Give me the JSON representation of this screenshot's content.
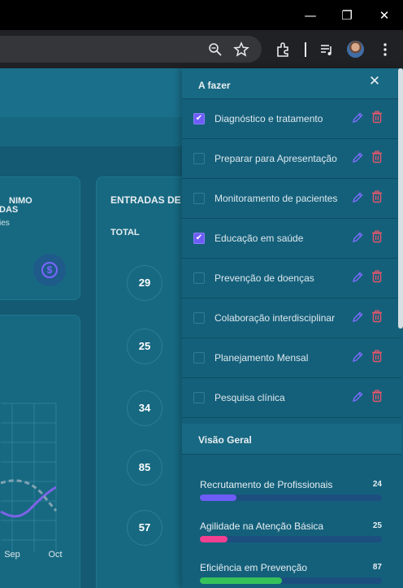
{
  "browser": {
    "window_buttons": [
      "—",
      "❐",
      "✕"
    ]
  },
  "dashboard": {
    "card_min": {
      "title_line1": "NIMO",
      "title_line2": "DAS",
      "subtitle": "ies"
    },
    "chart": {
      "x_labels": [
        "Sep",
        "Oct"
      ]
    },
    "entradas": {
      "title": "ENTRADAS DE",
      "total_label": "TOTAL",
      "values": [
        "29",
        "25",
        "34",
        "85",
        "57"
      ]
    }
  },
  "panel": {
    "title": "A fazer",
    "tasks": [
      {
        "label": "Diagnóstico e tratamento",
        "checked": true
      },
      {
        "label": "Preparar para Apresentação",
        "checked": false
      },
      {
        "label": "Monitoramento de pacientes",
        "checked": false
      },
      {
        "label": "Educação em saúde",
        "checked": true
      },
      {
        "label": "Prevenção de doenças",
        "checked": false
      },
      {
        "label": "Colaboração interdisciplinar",
        "checked": false
      },
      {
        "label": "Planejamento Mensal",
        "checked": false
      },
      {
        "label": "Pesquisa clínica",
        "checked": false
      }
    ],
    "overview": {
      "title": "Visão Geral",
      "items": [
        {
          "label": "Recrutamento de Profissionais",
          "value": "24",
          "fraction": 0.2,
          "color": "#6d5cf5"
        },
        {
          "label": "Agilidade na Atenção Básica",
          "value": "25",
          "fraction": 0.15,
          "color": "#f0408f"
        },
        {
          "label": "Eficiência em Prevenção",
          "value": "87",
          "fraction": 0.45,
          "color": "#35c15a"
        }
      ]
    }
  }
}
